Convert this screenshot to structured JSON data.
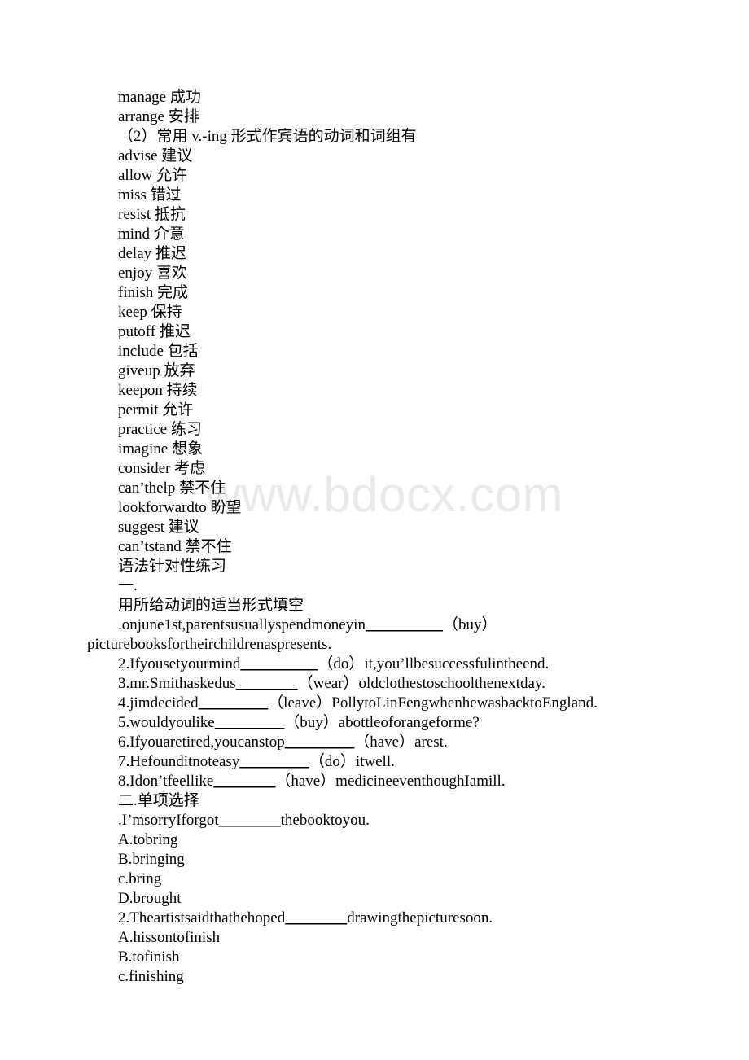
{
  "watermark": {
    "text": "www.bdocx.com",
    "color": "#e9e9e9"
  },
  "document": {
    "vocab_intro": [
      "manage 成功",
      "arrange 安排"
    ],
    "section_heading": "（2）常用 v.-ing 形式作宾语的动词和词组有",
    "vocab_list": [
      "advise 建议",
      "allow 允许",
      "miss 错过",
      "resist 抵抗",
      "mind 介意",
      "delay 推迟",
      "enjoy 喜欢",
      "finish 完成",
      "keep 保持",
      "putoff 推迟",
      "include 包括",
      "giveup 放弃",
      "keepon 持续",
      "permit 允许",
      "practice 练习",
      "imagine 想象",
      "consider 考虑",
      "can’thelp 禁不住",
      "lookforwardto 盼望",
      "suggest 建议",
      "can’tstand 禁不住"
    ],
    "practice_title": "语法针对性练习",
    "part_one_number": "一.",
    "part_one_instruction": "用所给动词的适当形式填空",
    "fill_in_items": [
      {
        "pre": ".onjune1st,parentsusuallyspendmoneyin",
        "blank": "__________",
        "post": "（buy）",
        "wrap": "picturebooksfortheirchildrenaspresents."
      },
      {
        "pre": "2.Ifyousetyourmind",
        "blank": "__________",
        "post": "（do）it,you’llbesuccessfulintheend.",
        "wrap": ""
      },
      {
        "pre": "3.mr.Smithaskedus",
        "blank": "________",
        "post": "（wear）oldclothestoschoolthenextday.",
        "wrap": ""
      },
      {
        "pre": "4.jimdecided",
        "blank": "_________",
        "post": "（leave）PollytoLinFengwhenhewasbacktoEngland.",
        "wrap": ""
      },
      {
        "pre": "5.wouldyoulike",
        "blank": "_________",
        "post": "（buy）abottleoforangeforme?",
        "wrap": ""
      },
      {
        "pre": "6.Ifyouaretired,youcanstop",
        "blank": "_________",
        "post": "（have）arest.",
        "wrap": ""
      },
      {
        "pre": "7.Hefounditnoteasy",
        "blank": "_________",
        "post": "（do）itwell.",
        "wrap": ""
      },
      {
        "pre": "8.Idon’tfeellike",
        "blank": "________",
        "post": "（have）medicineeventhoughIamill.",
        "wrap": ""
      }
    ],
    "part_two_title": "二.单项选择",
    "choice_questions": [
      {
        "pre": ".I’msorryIforgot",
        "blank": "________",
        "post": "thebooktoyou.",
        "options": [
          "A.tobring",
          "B.bringing",
          "c.bring",
          "D.brought"
        ]
      },
      {
        "pre": "2.Theartistsaidthathehoped",
        "blank": "________",
        "post": "drawingthepicturesoon.",
        "options": [
          "A.hissontofinish",
          "B.tofinish",
          "c.finishing"
        ]
      }
    ]
  }
}
